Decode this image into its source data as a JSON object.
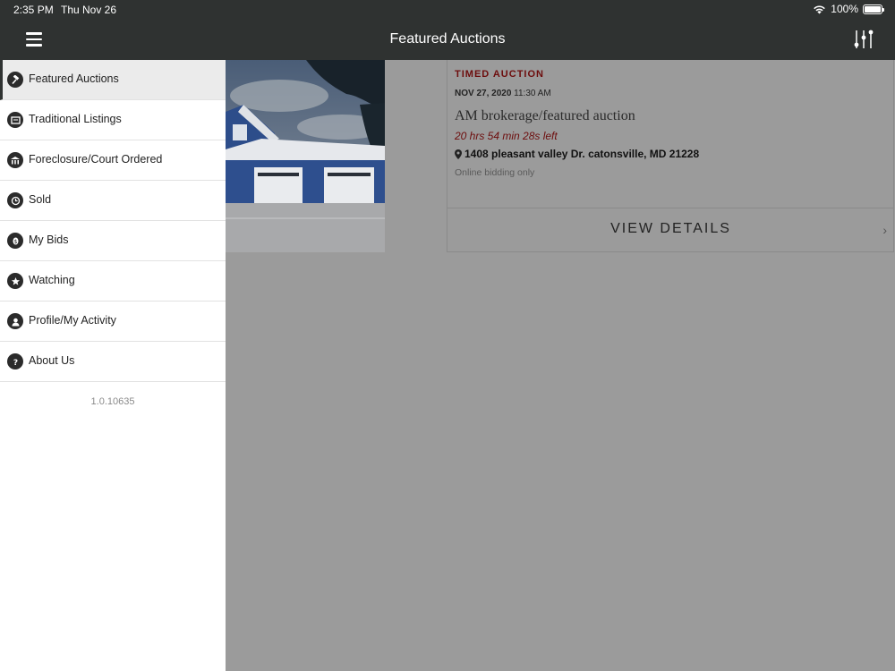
{
  "status_bar": {
    "time": "2:35 PM",
    "date": "Thu Nov 26",
    "battery": "100%"
  },
  "header": {
    "title": "Featured Auctions",
    "menu_icon": "hamburger-icon",
    "filter_icon": "sliders-icon"
  },
  "sidebar": {
    "items": [
      {
        "label": "Featured Auctions",
        "icon": "gavel-icon",
        "active": true
      },
      {
        "label": "Traditional Listings",
        "icon": "listing-icon",
        "active": false
      },
      {
        "label": "Foreclosure/Court Ordered",
        "icon": "courthouse-icon",
        "active": false
      },
      {
        "label": "Sold",
        "icon": "history-icon",
        "active": false
      },
      {
        "label": "My Bids",
        "icon": "dollar-icon",
        "active": false
      },
      {
        "label": "Watching",
        "icon": "star-icon",
        "active": false
      },
      {
        "label": "Profile/My Activity",
        "icon": "user-icon",
        "active": false
      },
      {
        "label": "About Us",
        "icon": "question-icon",
        "active": false
      }
    ],
    "version": "1.0.10635"
  },
  "listing": {
    "type": "TIMED AUCTION",
    "date": "NOV 27, 2020",
    "time": "11:30 AM",
    "title": "AM  brokerage/featured auction",
    "time_left": "20 hrs 54 min 28s left",
    "address": "1408 pleasant valley Dr. catonsville, MD 21228",
    "bidding": "Online bidding only",
    "details_label": "VIEW DETAILS"
  },
  "colors": {
    "bar": "#2f3231",
    "accent": "#6d0d0d",
    "overlay": "#9b9b9b"
  }
}
